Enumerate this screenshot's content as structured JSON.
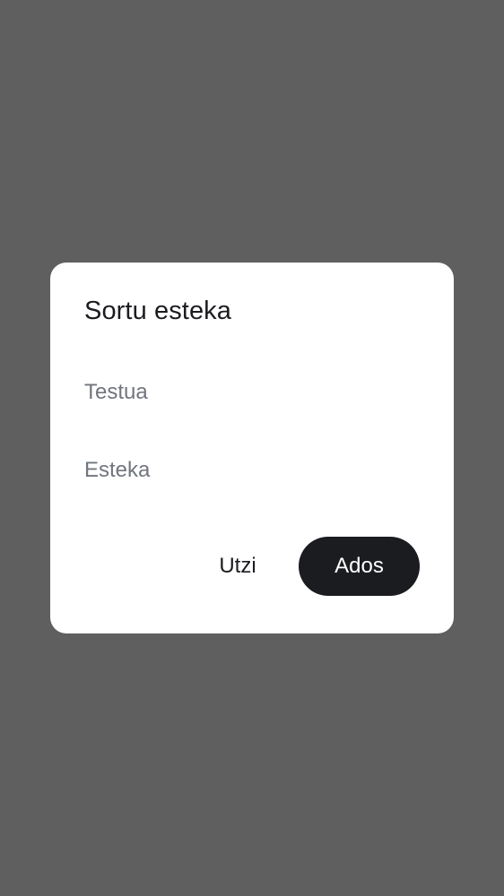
{
  "dialog": {
    "title": "Sortu esteka",
    "text_field": {
      "placeholder": "Testua",
      "value": ""
    },
    "link_field": {
      "placeholder": "Esteka",
      "value": ""
    },
    "cancel_label": "Utzi",
    "ok_label": "Ados"
  },
  "colors": {
    "scrim": "#5f5f5f",
    "surface": "#ffffff",
    "on_surface": "#1b1c20",
    "placeholder": "#71757d",
    "primary_button": "#1b1c20"
  }
}
